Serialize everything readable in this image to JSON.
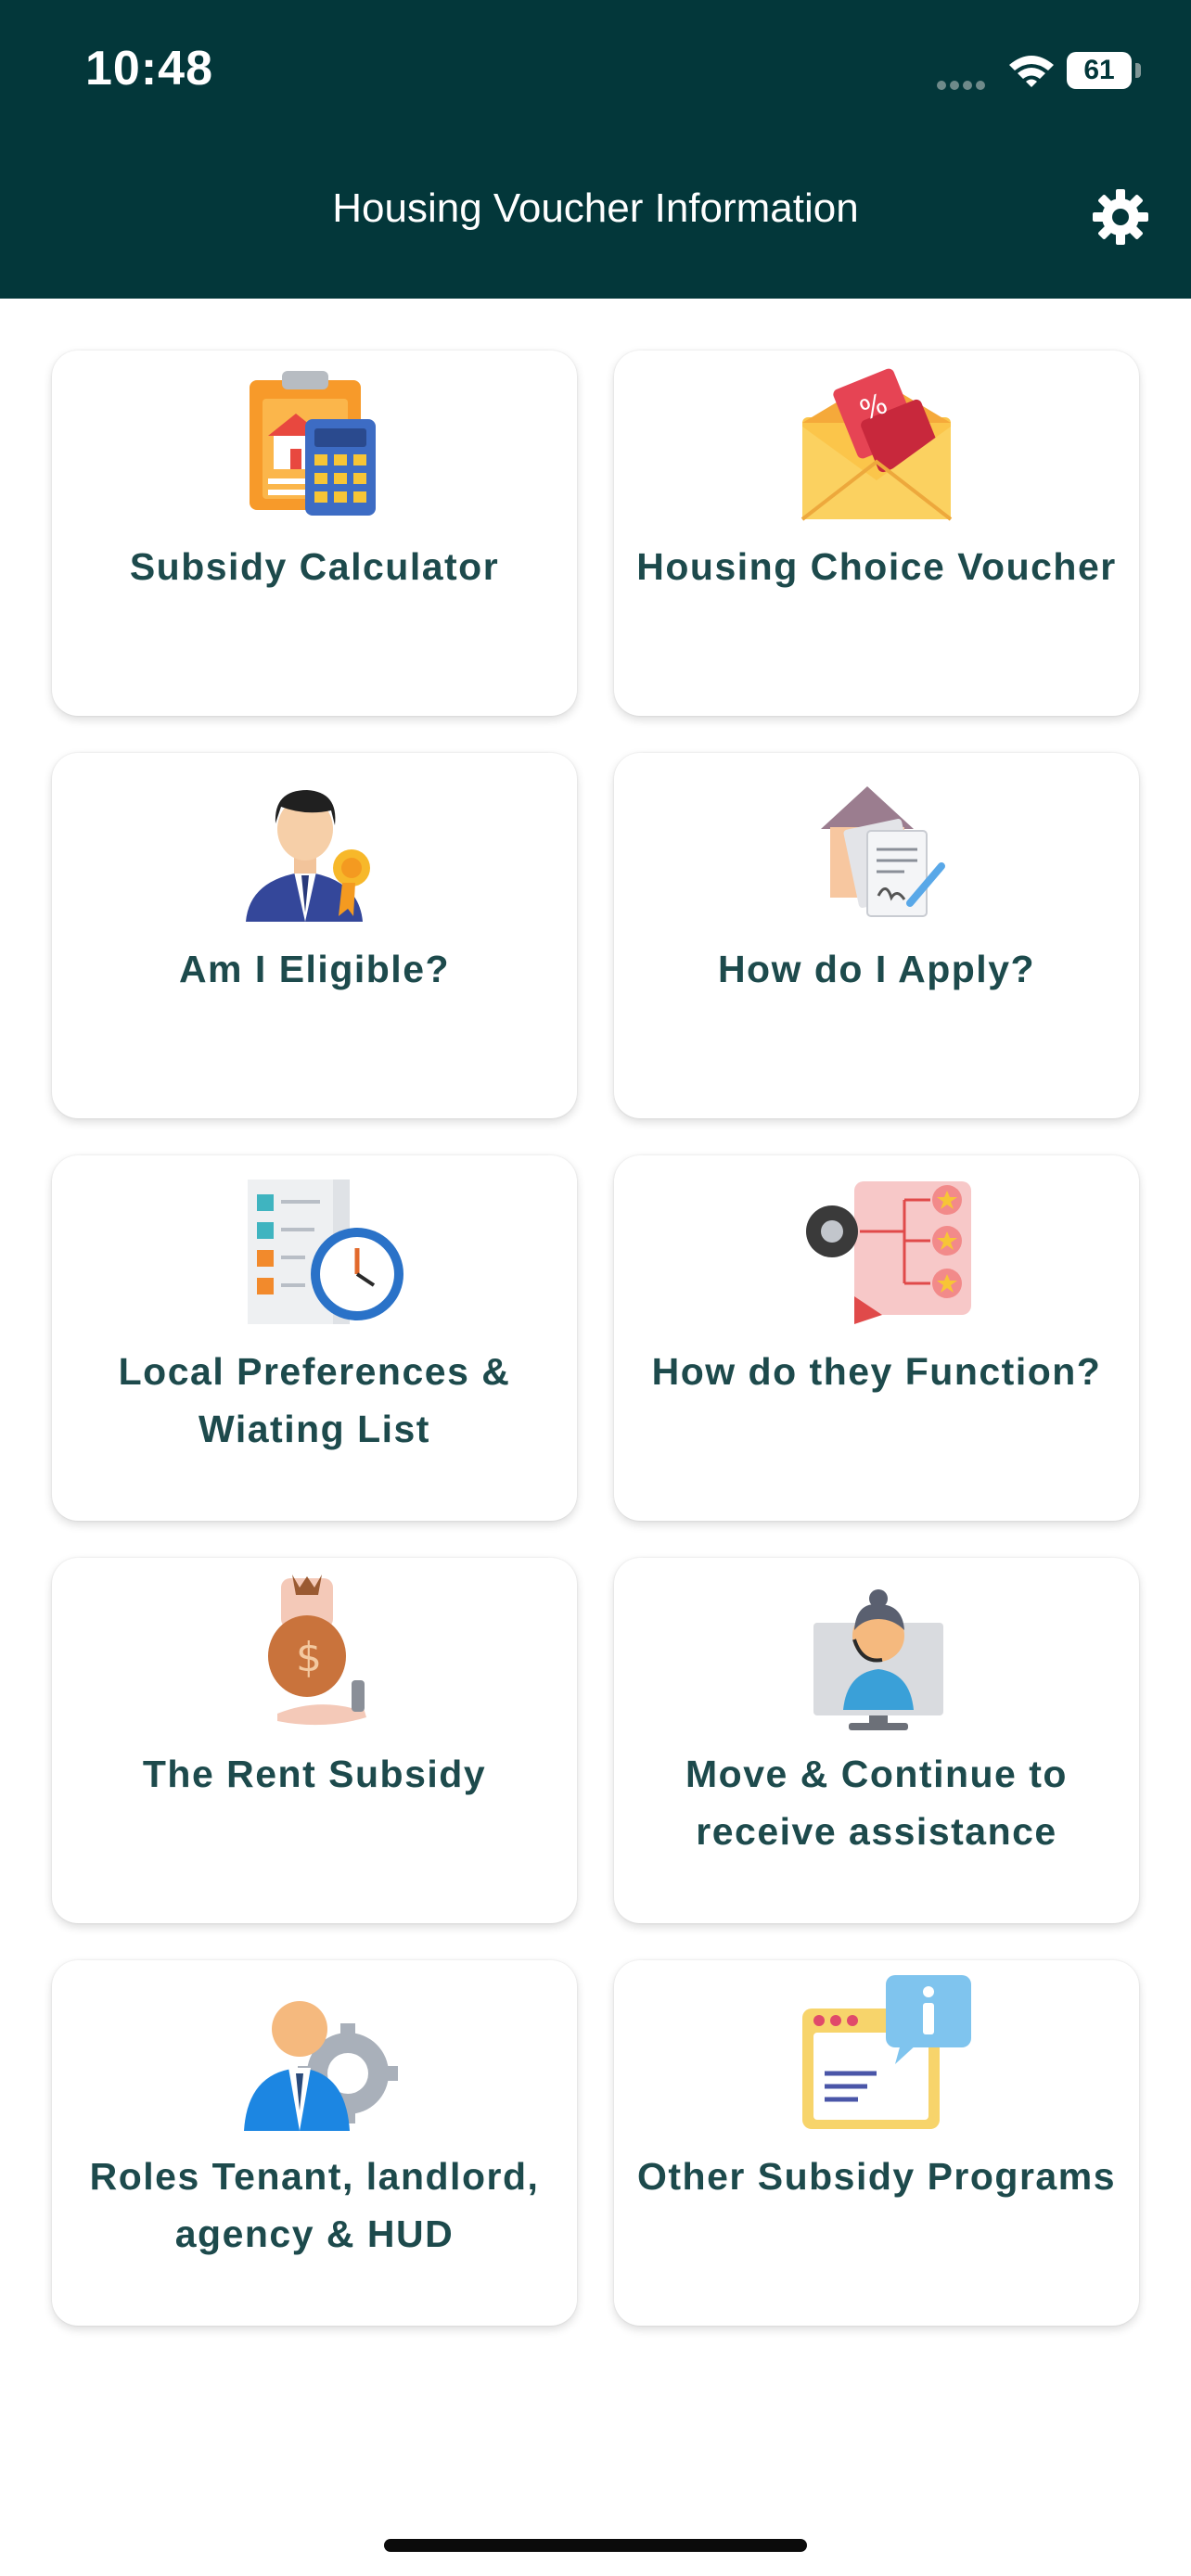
{
  "status_bar": {
    "time": "10:48",
    "battery": "61"
  },
  "header": {
    "title": "Housing Voucher Information"
  },
  "cards": [
    {
      "label": "Subsidy Calculator",
      "icon": "calculator-house-icon"
    },
    {
      "label": "Housing Choice Voucher",
      "icon": "voucher-envelope-icon"
    },
    {
      "label": "Am I Eligible?",
      "icon": "eligible-person-icon"
    },
    {
      "label": "How do I Apply?",
      "icon": "application-form-icon"
    },
    {
      "label": "Local Preferences & Wiating List",
      "icon": "waiting-list-clock-icon"
    },
    {
      "label": "How do they Function?",
      "icon": "function-gear-icon"
    },
    {
      "label": "The Rent Subsidy",
      "icon": "money-bag-icon"
    },
    {
      "label": "Move & Continue to receive assistance",
      "icon": "support-agent-icon"
    },
    {
      "label": "Roles Tenant, landlord, agency & HUD",
      "icon": "roles-person-gear-icon"
    },
    {
      "label": "Other Subsidy Programs",
      "icon": "info-window-icon"
    }
  ],
  "colors": {
    "header": "#03373a",
    "label": "#1d4a4c"
  }
}
